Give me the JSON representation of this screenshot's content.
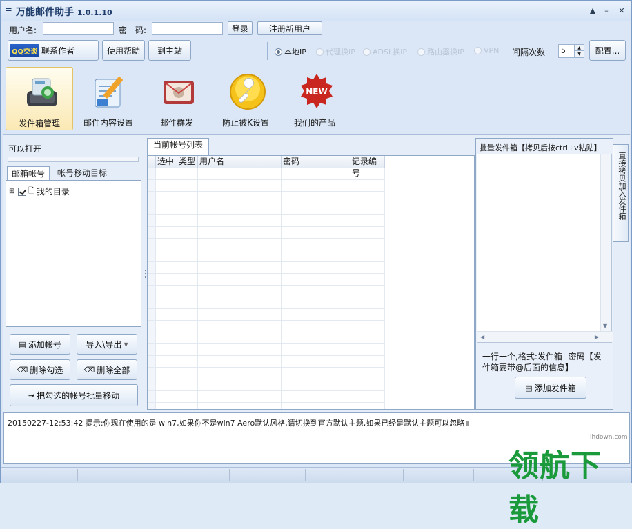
{
  "window": {
    "title": "万能邮件助手",
    "version": "1.0.1.10",
    "sysmenu_glyph": "=",
    "controls": [
      "▲",
      "–",
      "✕"
    ]
  },
  "login": {
    "username_label": "用户名:",
    "username_value": "",
    "password_label": "密　码:",
    "password_value": "",
    "login_button": "登录",
    "register_button": "注册新用户"
  },
  "toolbar": {
    "qq_logo": "QQ交谈",
    "contact_label": "联系作者",
    "help_button": "使用帮助",
    "site_button": "到主站",
    "ip_options": [
      {
        "label": "本地IP",
        "selected": true
      },
      {
        "label": "代理换IP",
        "selected": false
      },
      {
        "label": "ADSL换IP",
        "selected": false
      },
      {
        "label": "路由器换IP",
        "selected": false
      },
      {
        "label": "VPN",
        "selected": false
      }
    ],
    "interval_label": "间隔次数",
    "interval_value": "5",
    "config_button": "配置..."
  },
  "tiles": [
    {
      "label": "发件箱管理",
      "icon": "mailbox-manage-icon",
      "active": true
    },
    {
      "label": "邮件内容设置",
      "icon": "mail-content-icon",
      "active": false
    },
    {
      "label": "邮件群发",
      "icon": "mass-mail-icon",
      "active": false
    },
    {
      "label": "防止被K设置",
      "icon": "wrench-icon",
      "active": false
    },
    {
      "label": "我们的产品",
      "icon": "new-badge-icon",
      "active": false
    }
  ],
  "left_panel": {
    "open_label": "可以打开",
    "tabs": [
      "邮箱帐号",
      "帐号移动目标"
    ],
    "tree_root": "我的目录",
    "buttons": {
      "add_account": "添加帐号",
      "import_export": "导入\\导出",
      "delete_checked": "删除勾选",
      "delete_all": "删除全部",
      "batch_move": "把勾选的帐号批量移动"
    }
  },
  "center_panel": {
    "tab_label": "当前帐号列表",
    "columns": [
      "选中",
      "类型",
      "用户名",
      "密码",
      "记录编号"
    ]
  },
  "right_panel": {
    "header": "批量发件箱【拷贝后按ctrl+v粘贴】",
    "hint": "一行一个,格式:发件箱--密码【发件箱要带@后面的信息】",
    "add_button": "添加发件箱",
    "side_tab": "直接拷贝加入发件箱"
  },
  "log": {
    "text": "20150227-12:53:42  提示:你现在使用的是 win7,如果你不是win7 Aero默认风格,请切换到官方默认主题,如果已经是默认主题可以忽略"
  },
  "watermark": {
    "text": "领航下载",
    "url": "lhdown.com"
  }
}
